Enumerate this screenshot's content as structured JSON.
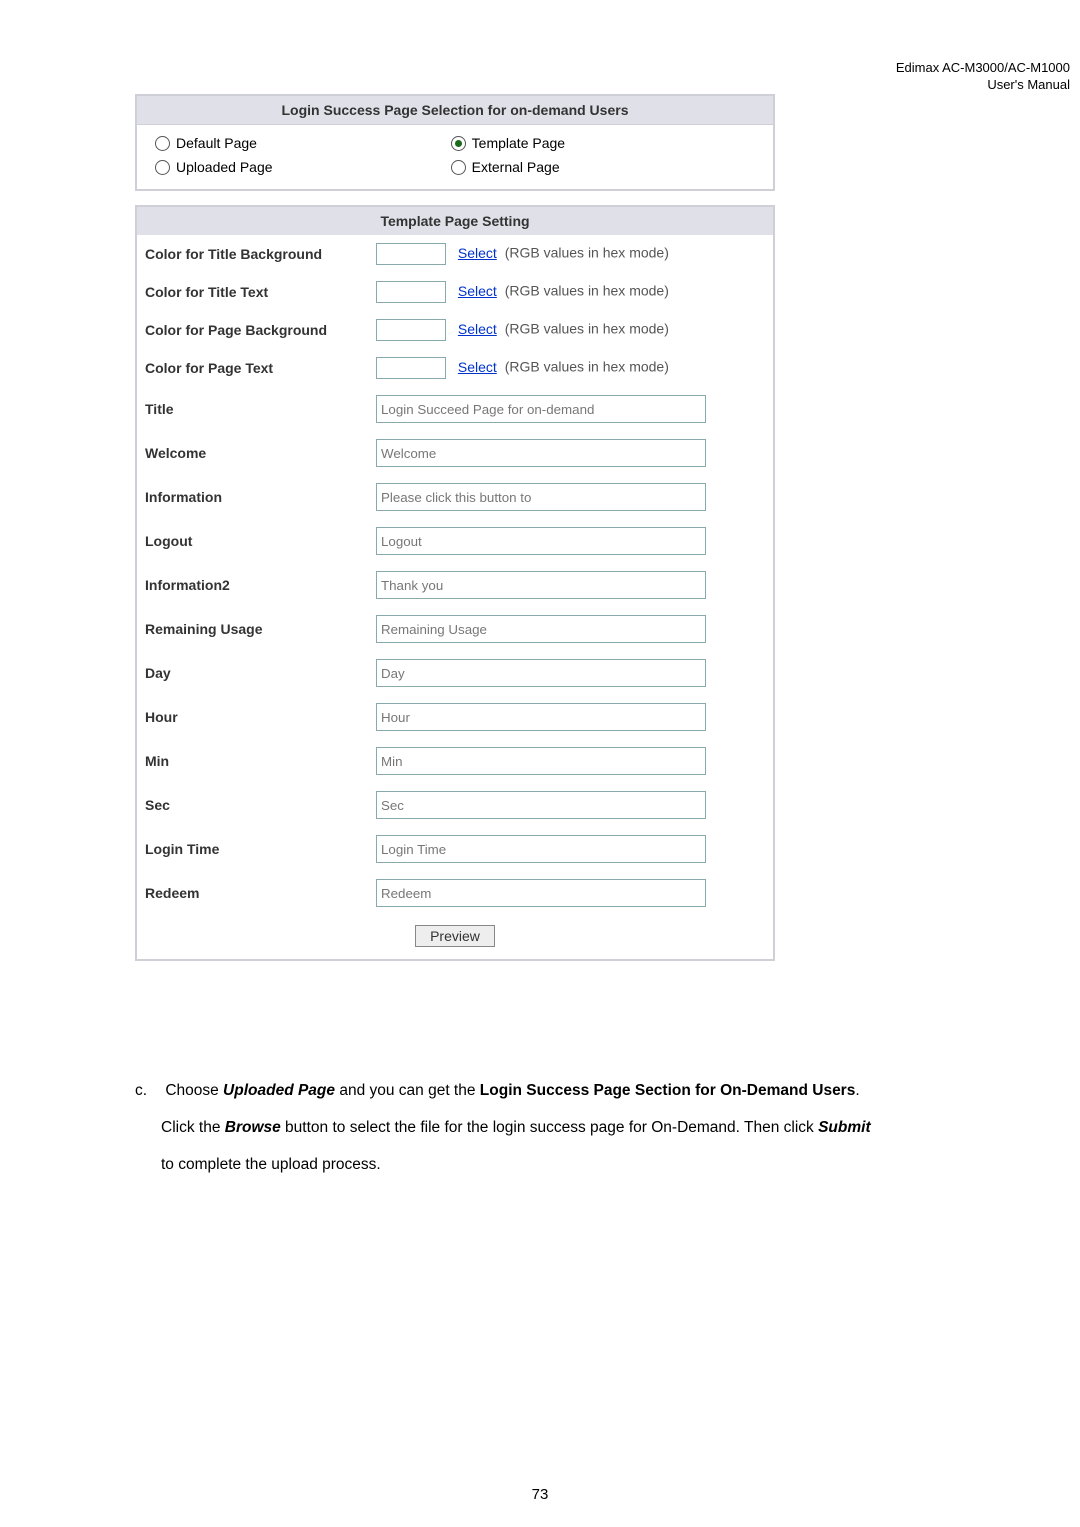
{
  "header": {
    "line1": "Edimax  AC-M3000/AC-M1000",
    "line2": "User's  Manual"
  },
  "selection": {
    "title": "Login Success Page Selection for on-demand Users",
    "opt_default": "Default Page",
    "opt_template": "Template Page",
    "opt_uploaded": "Uploaded Page",
    "opt_external": "External Page"
  },
  "template": {
    "title": "Template Page Setting",
    "select_label": "Select",
    "hint": "(RGB values in hex mode)",
    "rows": {
      "ctb": "Color for Title Background",
      "ctt": "Color for Title Text",
      "cpb": "Color for Page Background",
      "cpt": "Color for Page Text",
      "title": "Title",
      "welcome": "Welcome",
      "information": "Information",
      "logout": "Logout",
      "information2": "Information2",
      "remaining": "Remaining Usage",
      "day": "Day",
      "hour": "Hour",
      "min": "Min",
      "sec": "Sec",
      "login_time": "Login Time",
      "redeem": "Redeem"
    },
    "vals": {
      "title": "Login Succeed Page for on-demand",
      "welcome": "Welcome",
      "information": "Please click this button to",
      "logout": "Logout",
      "information2": "Thank you",
      "remaining": "Remaining Usage",
      "day": "Day",
      "hour": "Hour",
      "min": "Min",
      "sec": "Sec",
      "login_time": "Login Time",
      "redeem": "Redeem"
    },
    "preview": "Preview"
  },
  "paragraph": {
    "letter": "c.",
    "t1": "Choose ",
    "b1": "Uploaded Page",
    "t2": " and you can get the ",
    "b2": "Login Success Page Section for On-Demand Users",
    "t3": ". Click the ",
    "b3": "Browse",
    "t4": " button to select the file for the login success page for On-Demand. Then click ",
    "b4": "Submit",
    "t5": " to complete the upload process."
  },
  "pagenum": "73"
}
